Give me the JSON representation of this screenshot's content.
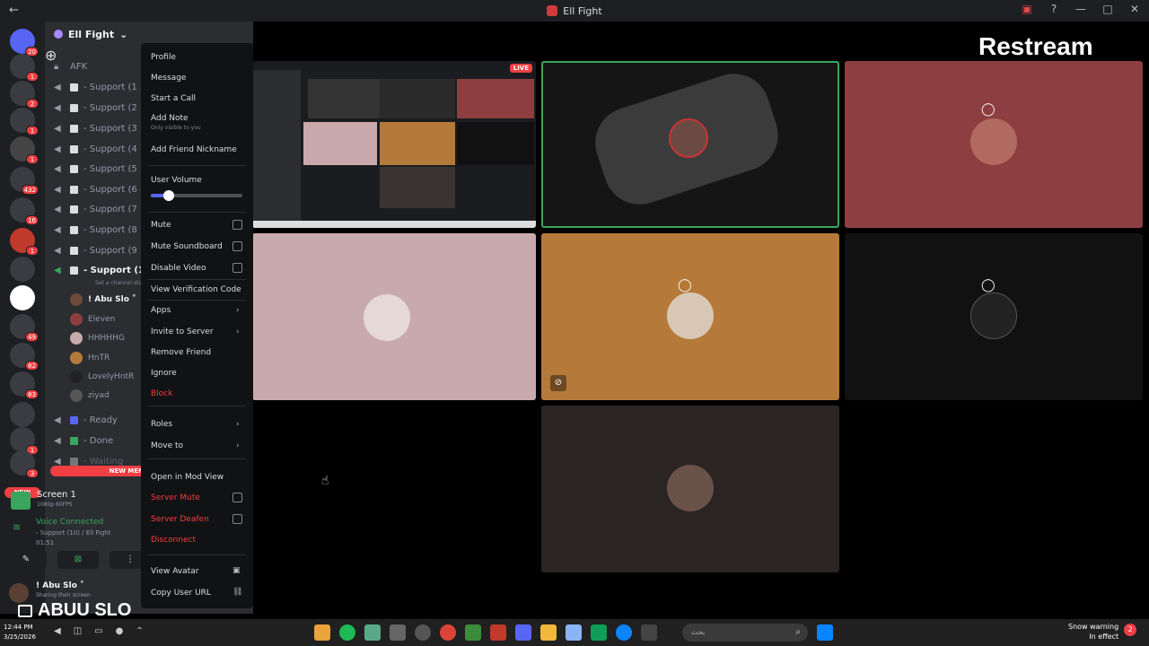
{
  "window": {
    "title": "Ell Fight"
  },
  "server": {
    "name": "Ell Fight"
  },
  "channels": [
    {
      "label": "AFK"
    },
    {
      "label": "- Support (1"
    },
    {
      "label": "- Support (2"
    },
    {
      "label": "- Support (3"
    },
    {
      "label": "- Support (4"
    },
    {
      "label": "- Support (5"
    },
    {
      "label": "- Support (6"
    },
    {
      "label": "- Support (7"
    },
    {
      "label": "- Support (8"
    },
    {
      "label": "- Support (9"
    },
    {
      "label": "- Support (1("
    }
  ],
  "channel_status_hint": "Set a channel status",
  "voice_members": [
    "! Abu Slo ˚",
    "Eleven",
    "HHHHHG",
    "HnTR",
    "LovelyHntR",
    "ziyad"
  ],
  "extra_channels": [
    {
      "label": "- Ready"
    },
    {
      "label": "- Done"
    },
    {
      "label": "- Waiting"
    }
  ],
  "guild_badges": [
    "20",
    "1",
    "2",
    "1",
    "1",
    "432",
    "16",
    "1",
    "49",
    "82",
    "83",
    "1",
    "3"
  ],
  "new_label": "NEW",
  "new_mentions_label": "NEW MEN",
  "screen_share": {
    "title": "Screen 1",
    "subtitle": "1080p 60FPS"
  },
  "voice_connected": {
    "status": "Voice Connected",
    "channel": "- Support (10) / Ell Fight",
    "timer": "01:51"
  },
  "user_panel": {
    "name": "! Abu Slo ˚",
    "status": "Sharing their screen"
  },
  "context_menu": {
    "profile": "Profile",
    "message": "Message",
    "start_call": "Start a Call",
    "add_note": "Add Note",
    "add_note_hint": "Only visible to you",
    "add_friend_nickname": "Add Friend Nickname",
    "user_volume": "User Volume",
    "user_volume_level": 0.2,
    "mute": "Mute",
    "mute_soundboard": "Mute Soundboard",
    "disable_video": "Disable Video",
    "view_verification_code": "View Verification Code",
    "apps": "Apps",
    "invite_to_server": "Invite to Server",
    "remove_friend": "Remove Friend",
    "ignore": "Ignore",
    "block": "Block",
    "roles": "Roles",
    "move_to": "Move to",
    "open_in_mod_view": "Open in Mod View",
    "server_mute": "Server Mute",
    "server_deafen": "Server Deafen",
    "disconnect": "Disconnect",
    "view_avatar": "View Avatar",
    "copy_user_url": "Copy User URL"
  },
  "stream": {
    "live_label": "LIVE"
  },
  "overlay": {
    "restream_label": "Restream",
    "caption": "ABUU SLO"
  },
  "taskbar": {
    "time": "12:44 PM",
    "date": "3/25/2026",
    "search_placeholder": "بحث",
    "warning_title": "Snow warning",
    "warning_sub": "In effect",
    "notification_count": "2"
  },
  "colors": {
    "accent": "#5865f2",
    "danger": "#f23f43",
    "connected": "#3ba55d",
    "tile_red": "#8d3e40",
    "tile_pink": "#c9aaac",
    "tile_orange": "#b57a3a",
    "tile_gray": "#2a2523"
  }
}
